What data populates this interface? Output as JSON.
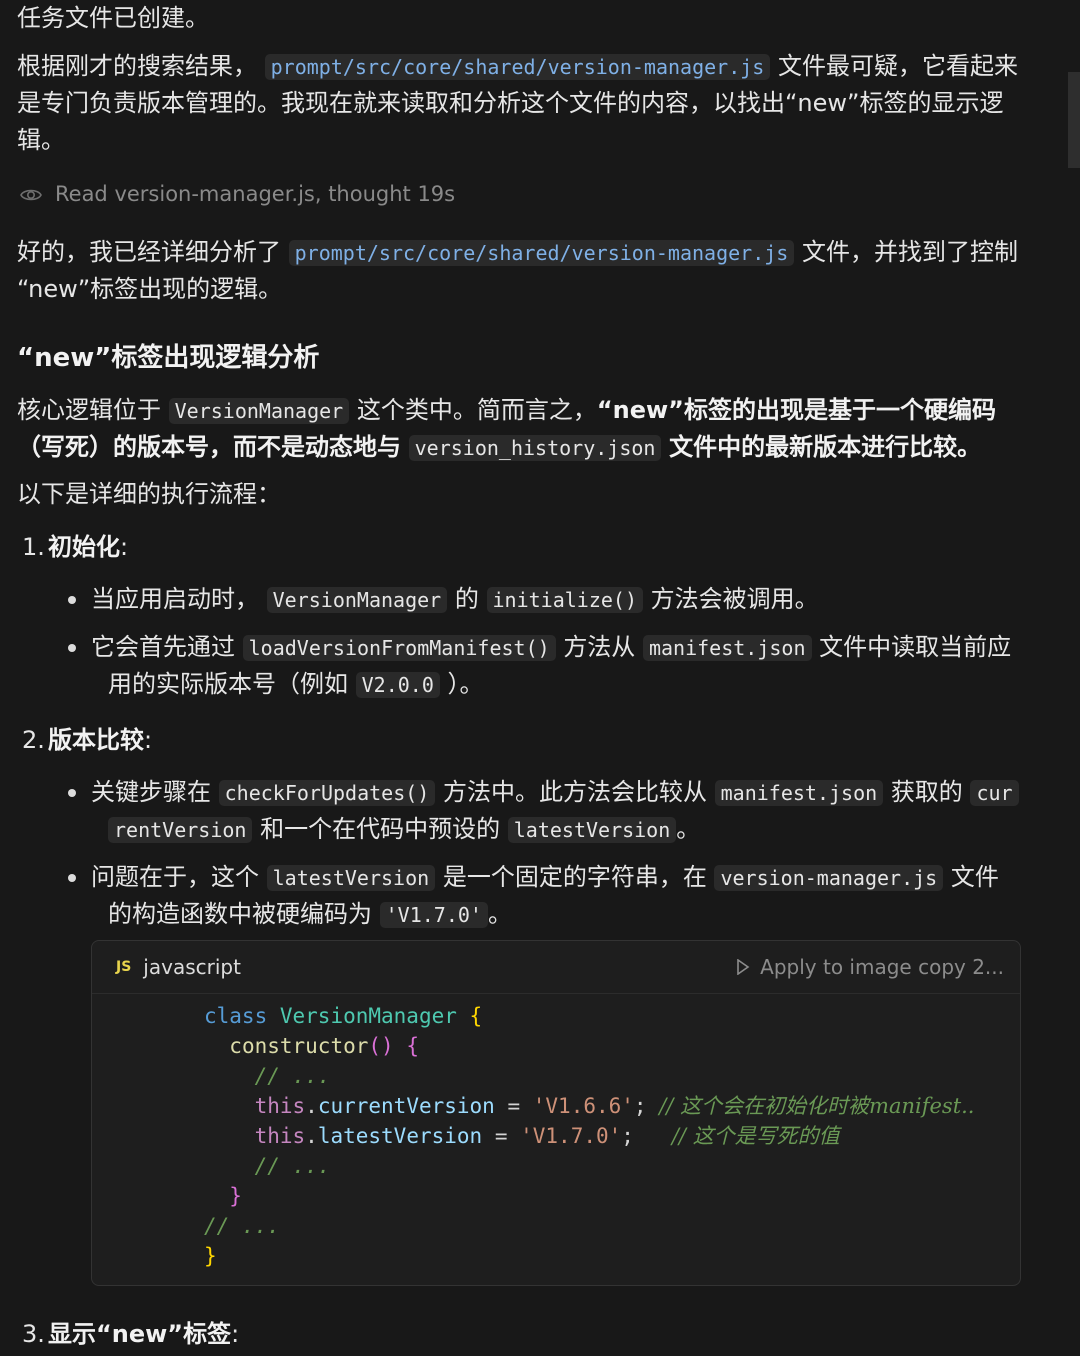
{
  "messages": {
    "task_created": "任务文件已创建。",
    "intro_before": "根据刚才的搜索结果，",
    "intro_file": "prompt/src/core/shared/version-manager.js",
    "intro_after_line1": "文件最可疑，它看起来",
    "intro_line2": "是专门负责版本管理的。我现在就来读取和分析这个文件的内容，以找出“new”标签的显示逻",
    "intro_line3": "辑。",
    "read_status": "Read version-manager.js, thought 19s",
    "analysis_before": "好的，我已经详细分析了",
    "analysis_file": "prompt/src/core/shared/version-manager.js",
    "analysis_after": "文件，并找到了控制",
    "analysis_line2": "“new”标签出现的逻辑。"
  },
  "section": {
    "heading": "“new”标签出现逻辑分析",
    "core_before": "核心逻辑位于",
    "core_class": "VersionManager",
    "core_after": "这个类中。简而言之，",
    "core_bold1": "“new”标签的出现是基于一个硬编码",
    "core_bold2": "（写死）的版本号，而不是动态地与",
    "core_json": "version_history.json",
    "core_bold3": "文件中的最新版本进行比较。",
    "flow_intro": "以下是详细的执行流程："
  },
  "steps": [
    {
      "number": "1.",
      "title": "初始化",
      "bullets": {
        "b1_before": "当应用启动时，",
        "b1_code1": "VersionManager",
        "b1_mid": "的",
        "b1_code2": "initialize()",
        "b1_after": "方法会被调用。",
        "b2_before": "它会首先通过",
        "b2_code1": "loadVersionFromManifest()",
        "b2_mid": "方法从",
        "b2_code2": "manifest.json",
        "b2_after": "文件中读取当前应",
        "b2_line2_before": "用的实际版本号（例如",
        "b2_code3": "V2.0.0",
        "b2_line2_after": "）。"
      }
    },
    {
      "number": "2.",
      "title": "版本比较",
      "bullets": {
        "b1_before": "关键步骤在",
        "b1_code1": "checkForUpdates()",
        "b1_mid": "方法中。此方法会比较从",
        "b1_code2": "manifest.json",
        "b1_mid2": "获取的",
        "b1_code3a": "cur",
        "b1_code3b": "rentVersion",
        "b1_mid3": "和一个在代码中预设的",
        "b1_code4": "latestVersion",
        "b1_end": "。",
        "b2_before": "问题在于，这个",
        "b2_code1": "latestVersion",
        "b2_mid": "是一个固定的字符串，在",
        "b2_code2": "version-manager.js",
        "b2_after": "文件",
        "b2_line2_before": "的构造函数中被硬编码为",
        "b2_code3": "'V1.7.0'",
        "b2_line2_after": "。"
      }
    },
    {
      "number": "3.",
      "title": "显示“new”标签"
    }
  ],
  "codeblock": {
    "language": "javascript",
    "badge": "JS",
    "apply_label": "Apply to image copy 2...",
    "lines": {
      "l1_kw": "class",
      "l1_cls": "VersionManager",
      "l2_fn": "constructor",
      "l3_cm": "// ...",
      "l4_prop": "currentVersion",
      "l4_str": "'V1.6.6'",
      "l4_cm": "// 这个会在初始化时被manifest..",
      "l5_prop": "latestVersion",
      "l5_str": "'V1.7.0'",
      "l5_cm": "// 这个是写死的值",
      "l6_cm": "// ...",
      "l8_cm": "// ...",
      "this_kw": "this"
    }
  },
  "colors": {
    "background": "#181818",
    "link_code": "#7fb0e6",
    "code_bg": "#2a2a2a"
  }
}
